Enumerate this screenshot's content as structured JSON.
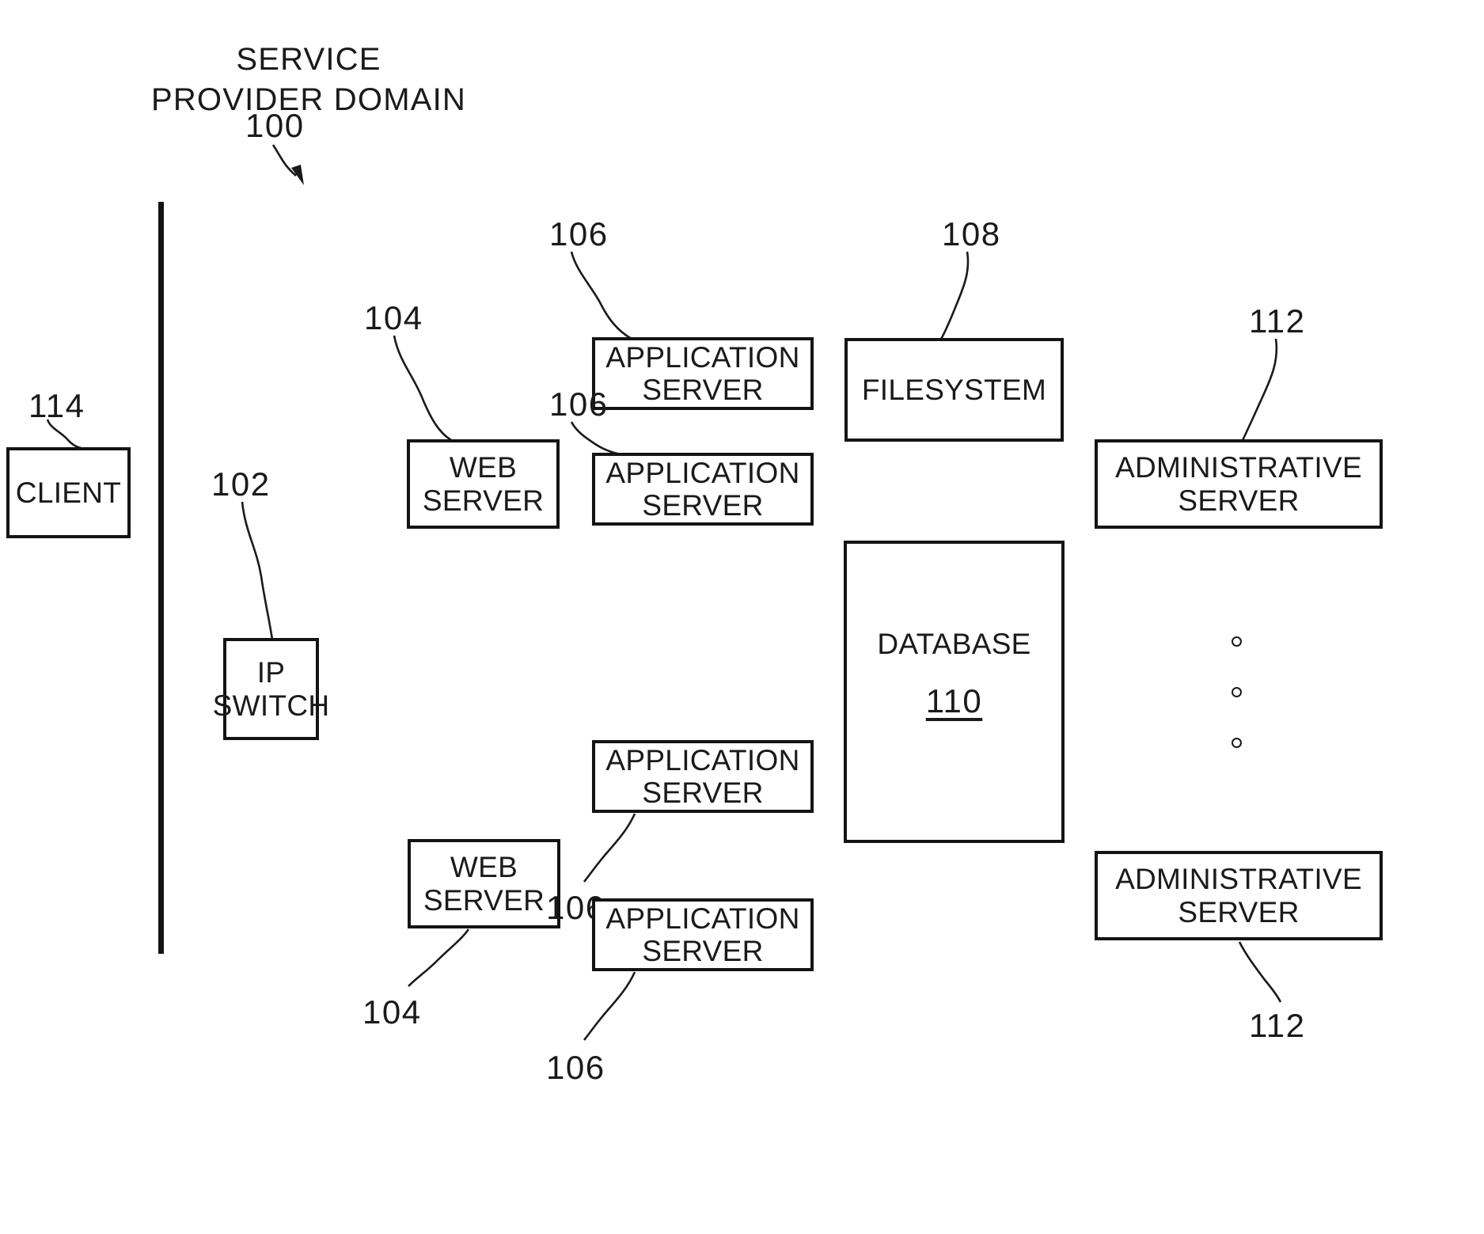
{
  "figure": {
    "title_lines": "SERVICE\nPROVIDER DOMAIN",
    "title_ref": "100"
  },
  "nodes": {
    "client": {
      "label_line1": "CLIENT",
      "ref": "114"
    },
    "ip_switch": {
      "label_line1": "IP",
      "label_line2": "SWITCH",
      "ref": "102"
    },
    "web_server_top": {
      "label_line1": "WEB",
      "label_line2": "SERVER",
      "ref": "104"
    },
    "web_server_bottom": {
      "label_line1": "WEB",
      "label_line2": "SERVER",
      "ref": "104"
    },
    "app_server_1": {
      "label_line1": "APPLICATION",
      "label_line2": "SERVER",
      "ref": "106"
    },
    "app_server_2": {
      "label_line1": "APPLICATION",
      "label_line2": "SERVER",
      "ref": "106"
    },
    "app_server_3": {
      "label_line1": "APPLICATION",
      "label_line2": "SERVER",
      "ref": "106"
    },
    "app_server_4": {
      "label_line1": "APPLICATION",
      "label_line2": "SERVER",
      "ref": "106"
    },
    "filesystem": {
      "label_line1": "FILESYSTEM",
      "ref": "108"
    },
    "database": {
      "label_line1": "DATABASE",
      "ref_inside": "110"
    },
    "admin_server_top": {
      "label_line1": "ADMINISTRATIVE",
      "label_line2": "SERVER",
      "ref": "112"
    },
    "admin_server_bottom": {
      "label_line1": "ADMINISTRATIVE",
      "label_line2": "SERVER",
      "ref": "112"
    }
  },
  "colors": {
    "ink": "#1a1a1a",
    "stroke": "#141414",
    "background": "#ffffff"
  }
}
